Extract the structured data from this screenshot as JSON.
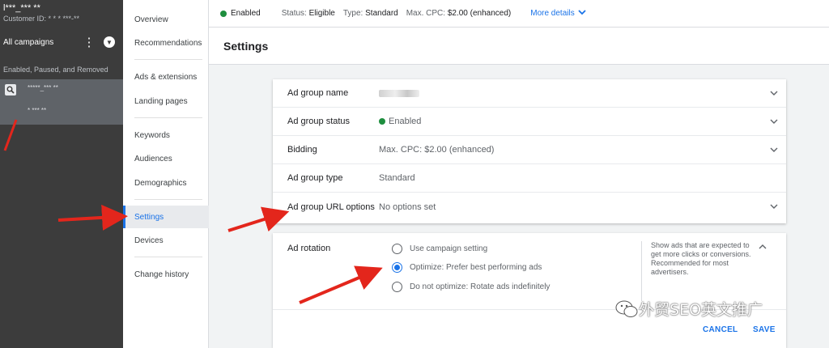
{
  "account": {
    "name": "l***_*** **",
    "customer_id": "Customer ID: * * *  ***-**"
  },
  "campaigns": {
    "label": "All campaigns",
    "filter": "Enabled, Paused, and Removed",
    "selected_campaign": "*****_*** **",
    "selected_adgroup": "* *** **"
  },
  "section_nav": {
    "items": [
      {
        "label": "Overview"
      },
      {
        "label": "Recommendations"
      },
      {
        "label": "Ads & extensions"
      },
      {
        "label": "Landing pages"
      },
      {
        "label": "Keywords"
      },
      {
        "label": "Audiences"
      },
      {
        "label": "Demographics"
      },
      {
        "label": "Settings"
      },
      {
        "label": "Devices"
      },
      {
        "label": "Change history"
      }
    ]
  },
  "status_bar": {
    "enabled": "Enabled",
    "status_label": "Status:",
    "status_value": "Eligible",
    "type_label": "Type:",
    "type_value": "Standard",
    "cpc_label": "Max. CPC:",
    "cpc_value": "$2.00 (enhanced)",
    "more_details": "More details"
  },
  "page_title": "Settings",
  "settings": {
    "rows": [
      {
        "label": "Ad group name",
        "value": ""
      },
      {
        "label": "Ad group status",
        "value": "Enabled"
      },
      {
        "label": "Bidding",
        "value": "Max. CPC: $2.00 (enhanced)"
      },
      {
        "label": "Ad group type",
        "value": "Standard"
      },
      {
        "label": "Ad group URL options",
        "value": "No options set"
      }
    ]
  },
  "ad_rotation": {
    "label": "Ad rotation",
    "options": [
      {
        "label": "Use campaign setting",
        "selected": false
      },
      {
        "label": "Optimize: Prefer best performing ads",
        "selected": true
      },
      {
        "label": "Do not optimize: Rotate ads indefinitely",
        "selected": false
      }
    ],
    "help_text": "Show ads that are expected to get more clicks or conversions. Recommended for most advertisers.",
    "cancel": "CANCEL",
    "save": "SAVE"
  },
  "watermark": "外贸SEO英文推广",
  "colors": {
    "accent": "#1a73e8",
    "status_green": "#1e8e3e",
    "sidebar_dark": "#3c3c3c",
    "annotation_red": "#e3261c"
  }
}
